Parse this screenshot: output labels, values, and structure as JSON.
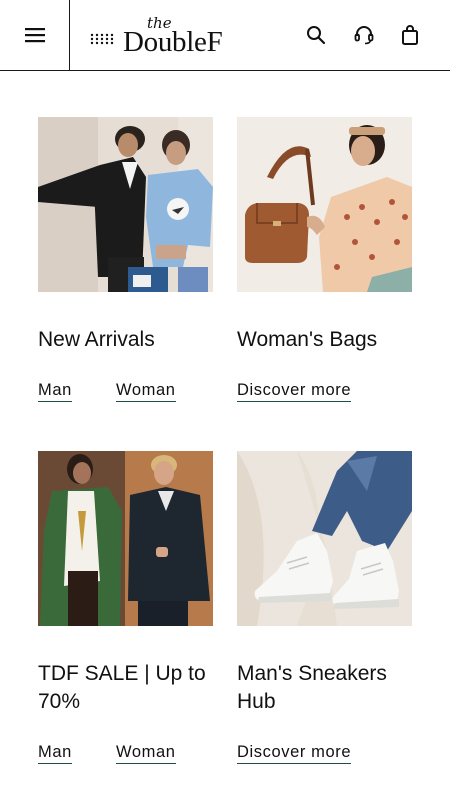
{
  "header": {
    "logo_small": "the",
    "logo_main": "DoubleF",
    "icons": [
      "menu-icon",
      "search-icon",
      "headset-icon",
      "shopping-bag-icon"
    ]
  },
  "cards": [
    {
      "title": "New Arrivals",
      "links": [
        "Man",
        "Woman"
      ]
    },
    {
      "title": "Woman's Bags",
      "links": [
        "Discover more"
      ]
    },
    {
      "title": "TDF SALE | Up to 70%",
      "links": [
        "Man",
        "Woman"
      ]
    },
    {
      "title": "Man's Sneakers Hub",
      "links": [
        "Discover more"
      ]
    }
  ],
  "colors": {
    "link_underline": "#1f4d4a",
    "header_border": "#1a1a1a"
  }
}
